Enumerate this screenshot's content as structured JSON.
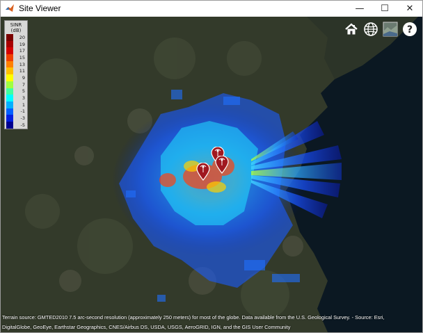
{
  "window": {
    "title": "Site Viewer",
    "minimize_glyph": "—",
    "maximize_glyph": "☐",
    "close_glyph": "✕"
  },
  "legend": {
    "title_line1": "SINR",
    "title_line2": "(dB)",
    "entries": [
      {
        "label": "20",
        "color": "#7a0000"
      },
      {
        "label": "19",
        "color": "#a80000"
      },
      {
        "label": "17",
        "color": "#d40000"
      },
      {
        "label": "15",
        "color": "#f04000"
      },
      {
        "label": "13",
        "color": "#ff8000"
      },
      {
        "label": "11",
        "color": "#ffc000"
      },
      {
        "label": "9",
        "color": "#ffff00"
      },
      {
        "label": "7",
        "color": "#a0ff40"
      },
      {
        "label": "5",
        "color": "#40ffa0"
      },
      {
        "label": "3",
        "color": "#00ffff"
      },
      {
        "label": "1",
        "color": "#00b0ff"
      },
      {
        "label": "-1",
        "color": "#0060ff"
      },
      {
        "label": "-3",
        "color": "#0020e0"
      },
      {
        "label": "-5",
        "color": "#000090"
      }
    ]
  },
  "toolbar": {
    "home_icon": "home-icon",
    "globe_icon": "globe-icon",
    "basemap_icon": "basemap-icon",
    "help_icon": "help-icon"
  },
  "attribution": {
    "line1": "Terrain source: GMTED2010 7.5 arc-second resolution (approximately 250 meters) for most of the globe. Data available from the U.S. Geological Survey. - Source: Esri,",
    "line2": "DigitalGlobe, GeoEye, Earthstar Geographics, CNES/Airbus DS, USDA, USGS, AeroGRID, IGN, and the GIS User Community"
  },
  "colors": {
    "ocean": "#0b1a24",
    "land": "#2c3324",
    "marker": "#a01820"
  }
}
